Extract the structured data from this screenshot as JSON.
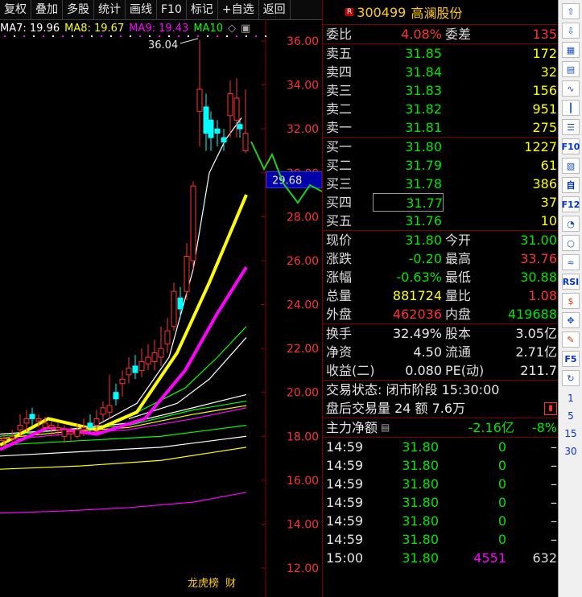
{
  "toolbar": {
    "items": [
      "复权",
      "叠加",
      "多股",
      "统计",
      "画线",
      "F10",
      "标记",
      "+自选",
      "返回"
    ]
  },
  "ma_legend": [
    {
      "label": "MA7: 19.96",
      "color": "#ffffff"
    },
    {
      "label": "MA8: 19.67",
      "color": "#ffff00"
    },
    {
      "label": "MA9: 19.43",
      "color": "#ff00ff"
    },
    {
      "label": "MA10",
      "color": "#00ff00"
    }
  ],
  "chart": {
    "y_ticks": [
      "36.00",
      "34.00",
      "32.00",
      "30.00",
      "28.00",
      "26.00",
      "24.00",
      "22.00",
      "20.00",
      "18.00",
      "16.00",
      "14.00",
      "12.00"
    ],
    "high_label": "36.04",
    "price_marker": "29.68",
    "badges": [
      "龙虎榜",
      "财"
    ]
  },
  "quote": {
    "r_badge": "R",
    "code": "300499",
    "name": "高澜股份",
    "weibi_label": "委比",
    "weibi_value": "4.08%",
    "weicha_label": "委差",
    "weicha_value": "135",
    "asks": [
      {
        "label": "卖五",
        "price": "31.85",
        "vol": "172"
      },
      {
        "label": "卖四",
        "price": "31.84",
        "vol": "32"
      },
      {
        "label": "卖三",
        "price": "31.83",
        "vol": "156"
      },
      {
        "label": "卖二",
        "price": "31.82",
        "vol": "951"
      },
      {
        "label": "卖一",
        "price": "31.81",
        "vol": "275"
      }
    ],
    "bids": [
      {
        "label": "买一",
        "price": "31.80",
        "vol": "1227"
      },
      {
        "label": "买二",
        "price": "31.79",
        "vol": "61"
      },
      {
        "label": "买三",
        "price": "31.78",
        "vol": "386"
      },
      {
        "label": "买四",
        "price": "31.77",
        "vol": "37"
      },
      {
        "label": "买五",
        "price": "31.76",
        "vol": "10"
      }
    ],
    "stats": [
      {
        "l1": "现价",
        "v1": "31.80",
        "c1": "grn",
        "l2": "今开",
        "v2": "31.00",
        "c2": "grn"
      },
      {
        "l1": "涨跌",
        "v1": "-0.20",
        "c1": "grn",
        "l2": "最高",
        "v2": "33.76",
        "c2": "red"
      },
      {
        "l1": "涨幅",
        "v1": "-0.63%",
        "c1": "grn",
        "l2": "最低",
        "v2": "30.88",
        "c2": "grn"
      },
      {
        "l1": "总量",
        "v1": "881724",
        "c1": "yel",
        "l2": "量比",
        "v2": "1.08",
        "c2": "red"
      },
      {
        "l1": "外盘",
        "v1": "462036",
        "c1": "red",
        "l2": "内盘",
        "v2": "419688",
        "c2": "grn"
      }
    ],
    "stats2": [
      {
        "l1": "换手",
        "v1": "32.49%",
        "l2": "股本",
        "v2": "3.05亿"
      },
      {
        "l1": "净资",
        "v1": "4.50",
        "l2": "流通",
        "v2": "2.71亿"
      },
      {
        "l1": "收益(二)",
        "v1": "0.080",
        "l2": "PE(动)",
        "v2": "211.7"
      }
    ],
    "status_line": "交易状态: 闭市阶段 15:30:00",
    "after_line": "盘后交易量 24 额 7.6万",
    "main_flow_label": "主力净额",
    "main_flow_value": "-2.16亿",
    "main_flow_pct": "-8%",
    "ticks": [
      {
        "t": "14:59",
        "p": "31.80",
        "v": "0",
        "x": "–"
      },
      {
        "t": "14:59",
        "p": "31.80",
        "v": "0",
        "x": "–"
      },
      {
        "t": "14:59",
        "p": "31.80",
        "v": "0",
        "x": "–"
      },
      {
        "t": "14:59",
        "p": "31.80",
        "v": "0",
        "x": "–"
      },
      {
        "t": "14:59",
        "p": "31.80",
        "v": "0",
        "x": "–"
      },
      {
        "t": "14:59",
        "p": "31.80",
        "v": "0",
        "x": "–"
      },
      {
        "t": "15:00",
        "p": "31.80",
        "v": "4551",
        "x": "632"
      }
    ]
  },
  "sidebar": {
    "icons": [
      "up-arrow-icon",
      "down-arrow-icon",
      "report-icon",
      "table-icon",
      "line-chart-icon",
      "kline-icon",
      "list-icon",
      "f10-icon",
      "news-icon",
      "self-select-icon",
      "f12-icon",
      "stat-icon",
      "circle-icon",
      "wave-icon",
      "rsi-icon",
      "money-icon",
      "move-icon",
      "pencil-icon",
      "f5-icon",
      "refresh-icon"
    ],
    "labels": [
      "F10",
      "自",
      "F12",
      "RSI",
      "F5"
    ],
    "periods": [
      "1",
      "5",
      "15",
      "30"
    ]
  }
}
